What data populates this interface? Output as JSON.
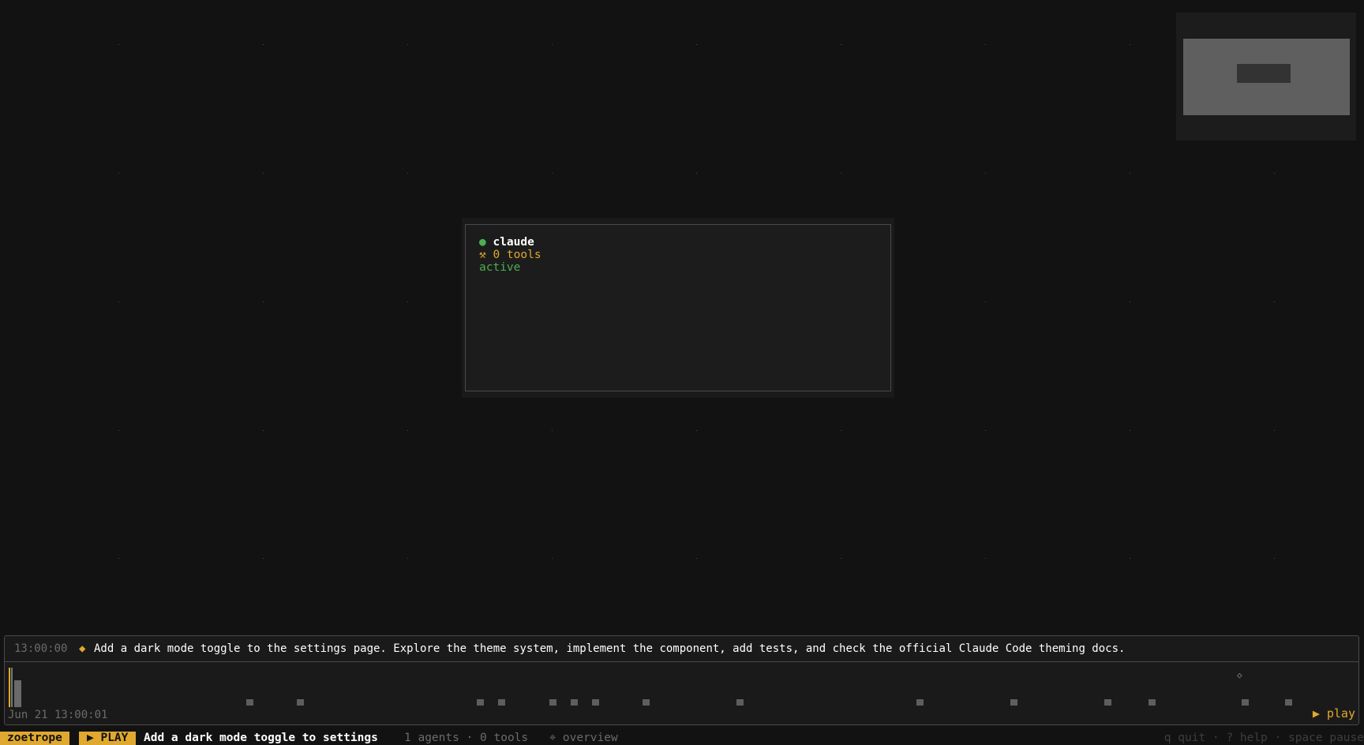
{
  "app": {
    "name": "zoetrope"
  },
  "agent_card": {
    "status_dot": "●",
    "name": "claude",
    "tools_icon": "⚒",
    "tools_label": "0 tools",
    "status": "active"
  },
  "timeline": {
    "event": {
      "time": "13:00:00",
      "diamond": "◆",
      "text": "Add a dark mode toggle to the settings page. Explore the theme system, implement the component, add tests, and check the official Claude Code theming docs."
    },
    "date": "Jun 21 13:00:01",
    "play_label": "▶ play",
    "diamond_marker": "◇"
  },
  "statusbar": {
    "app_badge": "zoetrope",
    "mode_badge": "▶ PLAY",
    "session_title": "Add a dark mode toggle to settings",
    "counts": "1 agents · 0 tools",
    "view_mode": "⌖ overview",
    "hints": "q quit · ? help · space pause"
  },
  "colors": {
    "accent": "#e0a82e",
    "active": "#4caf50",
    "background": "#121212"
  }
}
